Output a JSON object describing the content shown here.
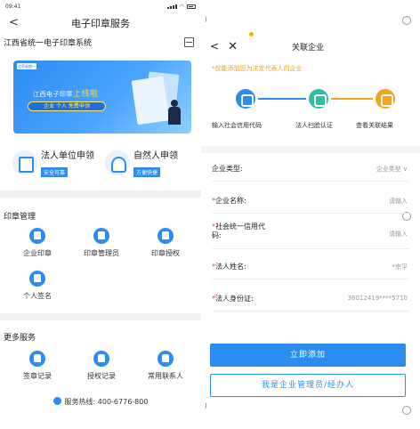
{
  "left": {
    "status": {
      "time": "09:41"
    },
    "nav": {
      "back": "<",
      "title": "电子印章服务"
    },
    "system_name": "江西省统一电子印章系统",
    "banner": {
      "logo_text": "江西省统一",
      "line1_pre": "江西电子印章",
      "line1_hl": "上线啦",
      "pill": "企业 个人 免费申领"
    },
    "cards": [
      {
        "title": "法人单位申领",
        "tag": "安全可靠"
      },
      {
        "title": "自然人申领",
        "tag": "方便快捷"
      }
    ],
    "seal_mgmt": {
      "title": "印章管理",
      "items": [
        "企业印章",
        "印章管理员",
        "印章授权",
        "个人签名"
      ]
    },
    "more": {
      "title": "更多服务",
      "items": [
        "签章记录",
        "授权记录",
        "常用联系人"
      ]
    },
    "hotline": "服务热线: 400-6776-800"
  },
  "right": {
    "top_char": ")",
    "nav": {
      "back": "<",
      "close": "✕",
      "title": "关联企业"
    },
    "hint": "*仅能添加您为法定代表人的企业",
    "steps": [
      "输入社会信用代码",
      "法人扫脸认证",
      "查看关联结果"
    ],
    "fields": [
      {
        "label": "企业类型:",
        "value": "企业类型 ∨",
        "required": false
      },
      {
        "label": "企业名称:",
        "value": "请输入",
        "required": true
      },
      {
        "label": "社会统一信用代\n码:",
        "value": "请输入",
        "required": true
      },
      {
        "label": "法人姓名:",
        "value": "*宗平",
        "required": true
      },
      {
        "label": "法人身份证:",
        "value": "36012419****5710",
        "required": true
      }
    ],
    "btn_add": "立即添加",
    "btn_admin": "我是企业管理员/经办人",
    "bottom_char": ")"
  },
  "colors": {
    "primary": "#2d8cf0",
    "teal": "#2fbfa6",
    "orange": "#f3a41c",
    "required": "#e64545",
    "hint": "#f0a020"
  }
}
